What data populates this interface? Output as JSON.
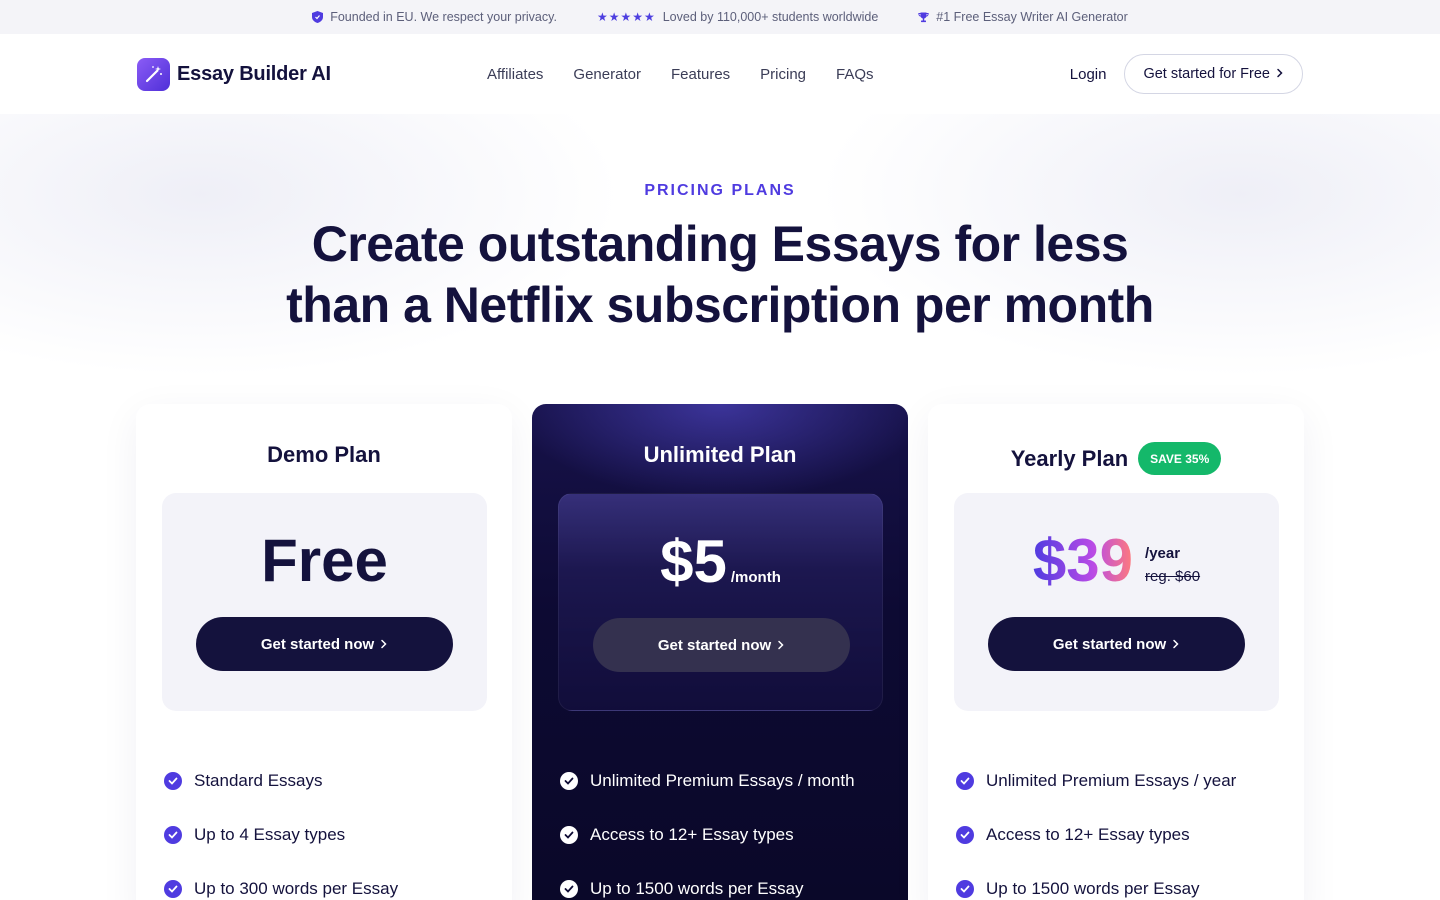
{
  "topbar": {
    "privacy": "Founded in EU. We respect your privacy.",
    "rating_stars": "★★★★★",
    "students": "Loved by 110,000+ students worldwide",
    "rank": "#1 Free Essay Writer AI Generator"
  },
  "header": {
    "logo": "Essay Builder AI",
    "nav": [
      "Affiliates",
      "Generator",
      "Features",
      "Pricing",
      "FAQs"
    ],
    "login": "Login",
    "cta": "Get started for Free"
  },
  "hero": {
    "eyebrow": "PRICING PLANS",
    "headline_line1": "Create outstanding Essays for less",
    "headline_line2": "than a Netflix subscription per month"
  },
  "plans": [
    {
      "title": "Demo Plan",
      "price": "Free",
      "button": "Get started now",
      "features": [
        "Standard Essays",
        "Up to 4 Essay types",
        "Up to 300 words per Essay"
      ]
    },
    {
      "title": "Unlimited Plan",
      "price": "$5",
      "period": "/month",
      "button": "Get started now",
      "features": [
        "Unlimited Premium Essays / month",
        "Access to 12+ Essay types",
        "Up to 1500 words per Essay"
      ]
    },
    {
      "title": "Yearly Plan",
      "badge": "SAVE 35%",
      "price": "$39",
      "period": "/year",
      "regular": "reg. $60",
      "button": "Get started now",
      "features": [
        "Unlimited Premium Essays / year",
        "Access to 12+ Essay types",
        "Up to 1500 words per Essay"
      ]
    }
  ],
  "colors": {
    "primary": "#14123d",
    "accent": "#4f3be0",
    "badge": "#14b86a"
  }
}
